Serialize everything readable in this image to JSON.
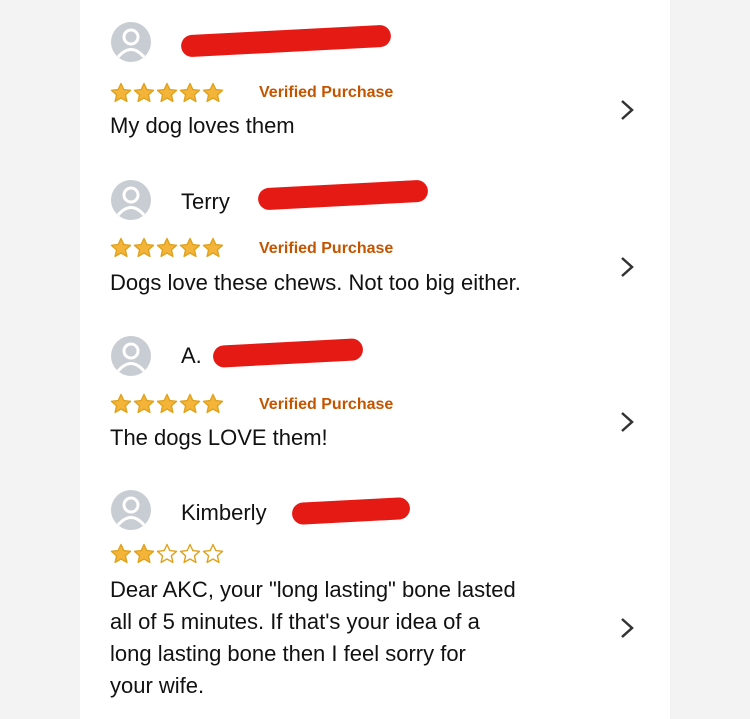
{
  "reviews": [
    {
      "reviewer": "",
      "rating": 5,
      "verified_label": "Verified Purchase",
      "text": "My dog loves them"
    },
    {
      "reviewer": "Terry",
      "rating": 5,
      "verified_label": "Verified Purchase",
      "text": "Dogs love these chews. Not too big either."
    },
    {
      "reviewer": "A.",
      "rating": 5,
      "verified_label": "Verified Purchase",
      "text": "The dogs LOVE them!"
    },
    {
      "reviewer": "Kimberly",
      "rating": 2,
      "verified_label": "",
      "text_lines": [
        "Dear AKC, your \"long lasting\" bone lasted",
        "all of 5 minutes. If that's your idea of a",
        "long lasting bone then I feel sorry for",
        "your wife."
      ]
    }
  ],
  "colors": {
    "star_fill": "#f4b43a",
    "star_outline": "#e0a21c",
    "verified": "#c45500",
    "redaction": "#e61a14",
    "avatar": "#c8ccd3"
  },
  "icons": {
    "avatar": "person-icon",
    "chevron": "chevron-right-icon",
    "star": "star-icon"
  }
}
